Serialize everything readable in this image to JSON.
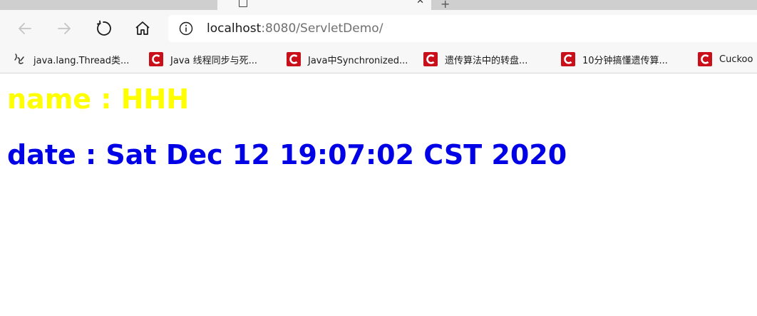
{
  "browser": {
    "address_bar": {
      "url_host": "localhost",
      "url_rest": ":8080/ServletDemo/"
    },
    "toolbar": {
      "back_icon": "arrow-left-icon",
      "forward_icon": "arrow-right-icon",
      "refresh_icon": "refresh-icon",
      "home_icon": "home-icon",
      "info_icon": "info-icon"
    },
    "bookmarks": [
      {
        "label": "java.lang.Thread类...",
        "icon": "bookmark-generic-icon"
      },
      {
        "label": "Java 线程同步与死...",
        "icon": "csdn-icon"
      },
      {
        "label": "Java中Synchronized...",
        "icon": "csdn-icon"
      },
      {
        "label": "遗传算法中的转盘...",
        "icon": "csdn-icon"
      },
      {
        "label": "10分钟搞懂遗传算...",
        "icon": "csdn-icon"
      },
      {
        "label": "Cuckoo",
        "icon": "csdn-icon"
      }
    ],
    "colors": {
      "csdn_red": "#c9101a",
      "name_color": "#ffff00",
      "date_color": "#0000e6"
    }
  },
  "page": {
    "name_line": "name : HHH",
    "date_line": "date : Sat Dec 12 19:07:02 CST 2020"
  }
}
